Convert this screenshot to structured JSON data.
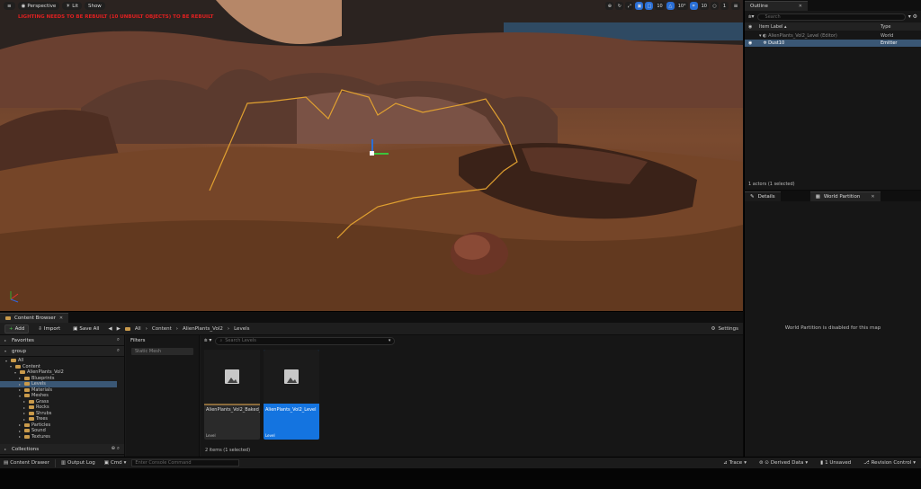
{
  "colors": {
    "accent": "#1474e0",
    "selection": "#3a5775",
    "warning": "#e02020",
    "folder": "#c99a4b"
  },
  "viewport": {
    "perspective": "Perspective",
    "lit": "Lit",
    "show": "Show",
    "warning": "LIGHTING NEEDS TO BE REBUILT (10 UNBUILT OBJECTS) TO BE REBUILT",
    "tools": [
      "⊕",
      "↻",
      "⤢",
      "▣",
      "□",
      "10",
      "△",
      "10°",
      "⌗",
      "10",
      "○",
      "1"
    ],
    "menu": "≡"
  },
  "content_browser": {
    "tab": "Content Browser",
    "add": "Add",
    "import": "Import",
    "save_all": "Save All",
    "breadcrumbs": [
      "All",
      "Content",
      "AlienPlants_Vol2",
      "Levels"
    ],
    "settings": "Settings",
    "favorites": "Favorites",
    "group": "group",
    "tree": [
      {
        "label": "All",
        "depth": 0,
        "open": true,
        "sel": false
      },
      {
        "label": "Content",
        "depth": 1,
        "open": true,
        "sel": false
      },
      {
        "label": "AlienPlants_Vol2",
        "depth": 2,
        "open": true,
        "sel": false
      },
      {
        "label": "Blueprints",
        "depth": 3,
        "open": false,
        "sel": false
      },
      {
        "label": "Levels",
        "depth": 3,
        "open": false,
        "sel": true
      },
      {
        "label": "Materials",
        "depth": 3,
        "open": false,
        "sel": false
      },
      {
        "label": "Meshes",
        "depth": 3,
        "open": true,
        "sel": false
      },
      {
        "label": "Grass",
        "depth": 4,
        "open": false,
        "sel": false
      },
      {
        "label": "Rocks",
        "depth": 4,
        "open": false,
        "sel": false
      },
      {
        "label": "Shrubs",
        "depth": 4,
        "open": false,
        "sel": false
      },
      {
        "label": "Trees",
        "depth": 4,
        "open": false,
        "sel": false
      },
      {
        "label": "Particles",
        "depth": 3,
        "open": false,
        "sel": false
      },
      {
        "label": "Sound",
        "depth": 3,
        "open": false,
        "sel": false
      },
      {
        "label": "Textures",
        "depth": 3,
        "open": false,
        "sel": false
      }
    ],
    "collections": "Collections",
    "filters": "Filters",
    "filter_chip": "Static Mesh",
    "search_placeholder": "Search Levels",
    "assets": [
      {
        "name": "AlienPlants_Vol2_Baked_Level",
        "type": "Level",
        "selected": false
      },
      {
        "name": "AlienPlants_Vol2_Level",
        "type": "Level",
        "selected": true
      }
    ],
    "count": "2 items (1 selected)"
  },
  "outline": {
    "tab": "Outline",
    "search_placeholder": "Search",
    "col_label": "Item Label ▴",
    "col_type": "Type",
    "rows": [
      {
        "label": "AlienPlants_Vol2_Level (Editor)",
        "type": "World",
        "sel": false
      },
      {
        "label": "Dust10",
        "type": "Emitter",
        "sel": true
      }
    ],
    "actors": "1 actors (1 selected)"
  },
  "details": {
    "tab_details": "Details",
    "tab_wp": "World Partition",
    "message": "World Partition is disabled for this map"
  },
  "statusbar": {
    "content_drawer": "Content Drawer",
    "output_log": "Output Log",
    "cmd": "Cmd",
    "console_placeholder": "Enter Console Command",
    "trace": "Trace",
    "derived_data": "Derived Data",
    "unsaved": "1 Unsaved",
    "revision": "Revision Control"
  }
}
